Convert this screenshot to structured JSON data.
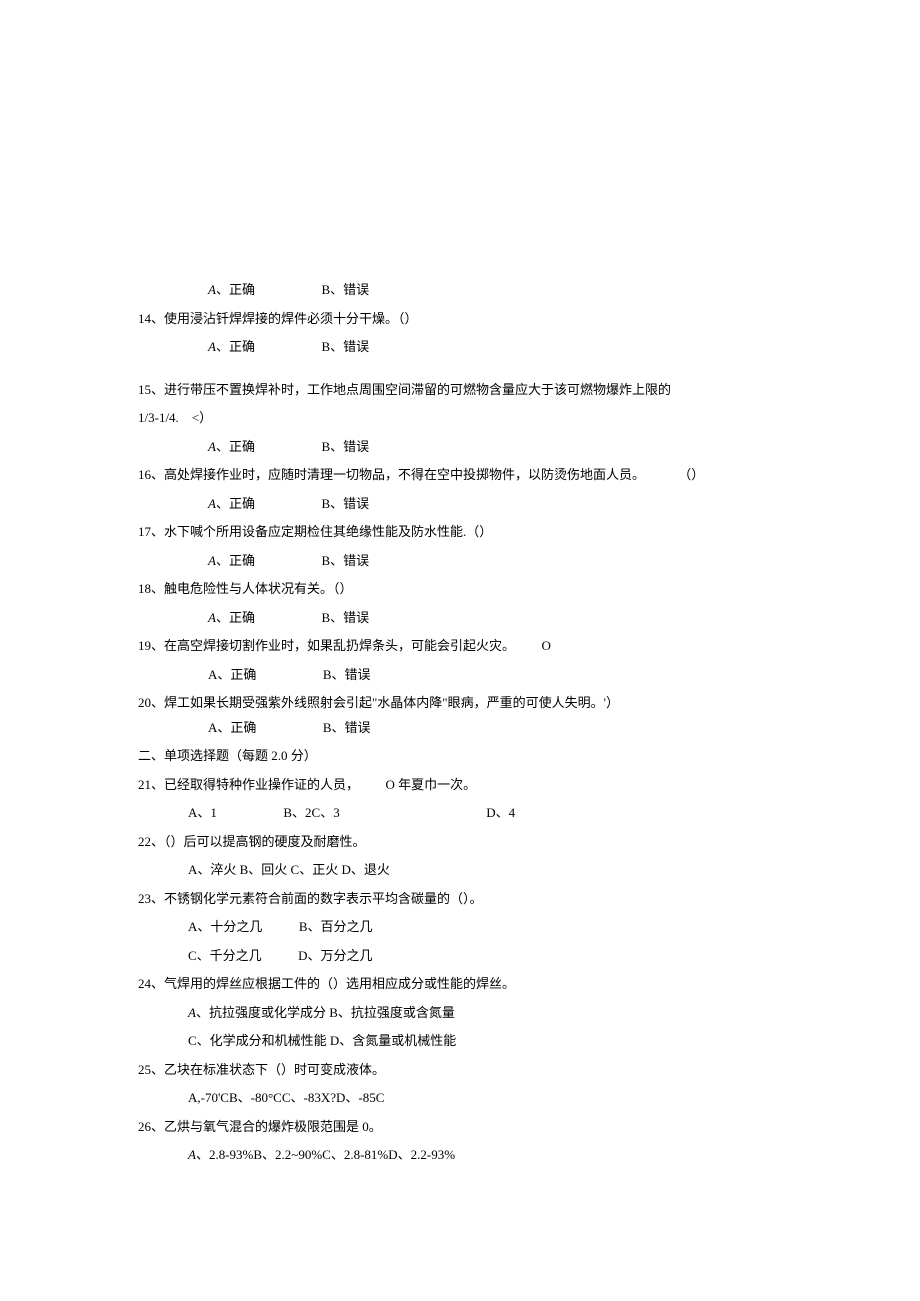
{
  "q13": {
    "optA_prefix": "A",
    "optA": "、正确",
    "optB": "B、错误"
  },
  "q14": {
    "stem": "14、使用浸沾钎焊焊接的焊件必须十分干燥。（）",
    "optA_prefix": "A",
    "optA": "、正确",
    "optB": "B、错误"
  },
  "q15": {
    "stem_line1": "15、进行带压不置换焊补时，工作地点周围空间滞留的可燃物含量应大于该可燃物爆炸上限的",
    "stem_line2": "1/3-1/4.　<）",
    "optA_prefix": "A",
    "optA": "、正确",
    "optB": "B、错误"
  },
  "q16": {
    "stem": "16、高处焊接作业时，应随时清理一切物品，不得在空中投掷物件，以防烫伤地面人员。",
    "paren": "（）",
    "optA_prefix": "A",
    "optA": "、正确",
    "optB": "B、错误"
  },
  "q17": {
    "stem": "17、水下喊个所用设备应定期检住其绝缘性能及防水性能.（）",
    "optA_prefix": "A",
    "optA": "、正确",
    "optB": "B、错误"
  },
  "q18": {
    "stem": "18、触电危险性与人体状况有关。（）",
    "optA_prefix": "A",
    "optA": "、正确",
    "optB": "B、错误"
  },
  "q19": {
    "stem": "19、在高空焊接切割作业时，如果乱扔焊条头，可能会引起火灾。",
    "tail": "O",
    "optA": "A、正确",
    "optB": "B、错误"
  },
  "q20": {
    "stem": "20、焊工如果长期受强紫外线照射会引起\"水晶体内降\"眼病，严重的可使人失明。'）",
    "optA": "A、正确",
    "optB": "B、错误"
  },
  "section2": "二、单项选择题（每题 2.0 分）",
  "q21": {
    "stem": "21、已经取得特种作业操作证的人员，",
    "tail": "O 年夏巾一次。",
    "optA": "A、1",
    "optB": "B、2C、3",
    "optD": "D、4"
  },
  "q22": {
    "stem": "22、（）后可以提高钢的硬度及耐磨性。",
    "opts": "A、淬火 B、回火 C、正火 D、退火"
  },
  "q23": {
    "stem": "23、不锈钢化学元素符合前面的数字表示平均含碳量的（）。",
    "line1_a": "A、十分之几",
    "line1_b": "B、百分之几",
    "line2_c": "C、千分之几",
    "line2_d": "D、万分之几"
  },
  "q24": {
    "stem": "24、气焊用的焊丝应根据工件的（）选用相应成分或性能的焊丝。",
    "line1_a_prefix": "A",
    "line1_a": "、抗拉强度或化学成分 B、抗拉强度或含氮量",
    "line2": "C、化学成分和机械性能 D、含氮量或机械性能"
  },
  "q25": {
    "stem": "25、乙块在标准状态下（）时可变成液体。",
    "opts": "A,-70'CB、-80°CC、-83X?D、-85C"
  },
  "q26": {
    "stem": "26、乙烘与氧气混合的爆炸极限范围是 0。",
    "opts_prefix": "A",
    "opts": "、2.8-93%B、2.2~90%C、2.8-81%D、2.2-93%"
  }
}
